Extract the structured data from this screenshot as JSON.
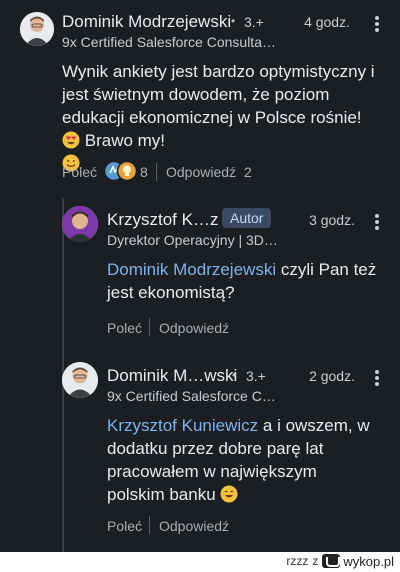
{
  "colors": {
    "background": "#1b1f23",
    "text": "#e9ebed",
    "muted": "#a9aeb4",
    "mention": "#7eb2ec",
    "author_badge_bg": "#3a4a62"
  },
  "comments": [
    {
      "author": "Dominik Modrzejewski",
      "degree": "3.+",
      "time": "4 godz.",
      "headline": "9x Certified Salesforce Consulta…",
      "text_part1": "Wynik ankiety jest bardzo optymistyczny i jest świetnym dowodem, że poziom edukacji ekonomicznej w Polsce rośnie!",
      "text_part2": "Brawo my!",
      "emoji_1": "heart-eyes-emoji",
      "emoji_2": "slight-smile-emoji",
      "like_label": "Poleć",
      "reaction_icons": [
        "celebrate-icon",
        "insightful-icon"
      ],
      "reaction_count": "8",
      "reply_label": "Odpowiedź",
      "reply_count": "2"
    },
    {
      "author": "Krzysztof K…z",
      "badge": "Autor",
      "time": "3 godz.",
      "headline": "Dyrektor Operacyjny | 3D…",
      "mention": "Dominik Modrzejewski",
      "text": " czyli Pan też jest ekonomistą?",
      "like_label": "Poleć",
      "reply_label": "Odpowiedź"
    },
    {
      "author": "Dominik M…wski",
      "degree": "3.+",
      "time": "2 godz.",
      "headline": "9x Certified Salesforce C…",
      "mention": "Krzysztof Kuniewicz",
      "text": " a i owszem, w dodatku przez dobre parę lat pracowałem w największym polskim banku",
      "emoji": "grinning-emoji",
      "like_label": "Poleć",
      "reply_label": "Odpowiedź"
    }
  ],
  "footer": {
    "user": "rzzz",
    "connector": "z",
    "site": "wykop.pl"
  }
}
